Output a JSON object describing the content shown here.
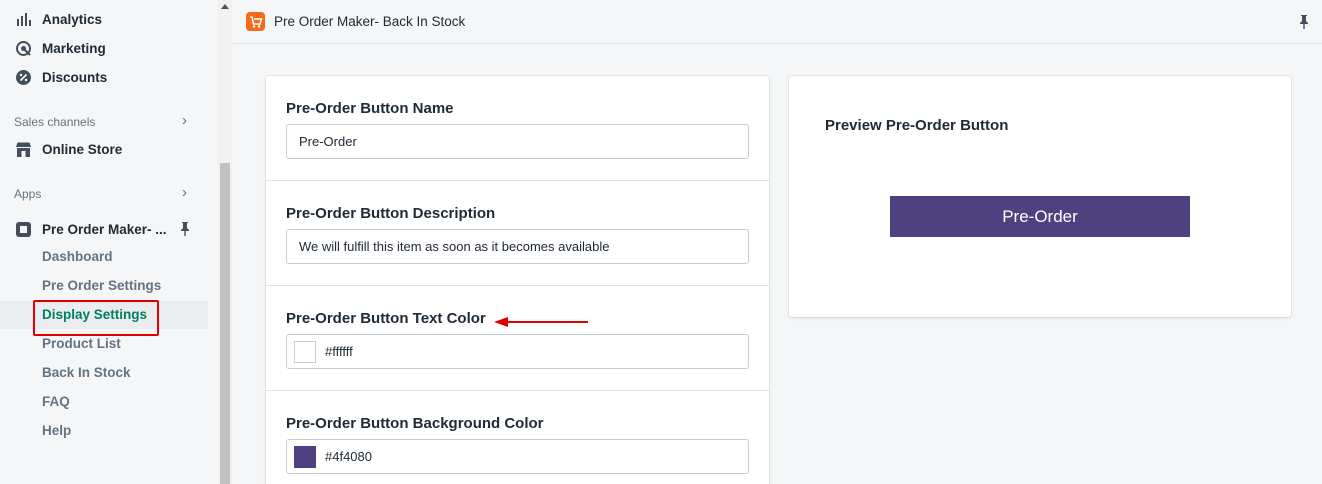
{
  "sidebar": {
    "nav": [
      {
        "label": "Analytics",
        "icon": "analytics-icon"
      },
      {
        "label": "Marketing",
        "icon": "marketing-icon"
      },
      {
        "label": "Discounts",
        "icon": "discounts-icon"
      }
    ],
    "sales_channels_label": "Sales channels",
    "online_store_label": "Online Store",
    "apps_label": "Apps",
    "app_name": "Pre Order Maker- ...",
    "sub_items": [
      "Dashboard",
      "Pre Order Settings",
      "Display Settings",
      "Product List",
      "Back In Stock",
      "FAQ",
      "Help"
    ],
    "active_item": "Display Settings"
  },
  "topbar": {
    "title": "Pre Order Maker- Back In Stock"
  },
  "form": {
    "button_name": {
      "label": "Pre-Order Button Name",
      "value": "Pre-Order"
    },
    "button_description": {
      "label": "Pre-Order Button Description",
      "value": "We will fulfill this item as soon as it becomes available"
    },
    "text_color": {
      "label": "Pre-Order Button Text Color",
      "value": "#ffffff"
    },
    "background_color": {
      "label": "Pre-Order Button Background Color",
      "value": "#4f4080"
    }
  },
  "preview": {
    "title": "Preview Pre-Order Button",
    "button_label": "Pre-Order"
  },
  "colors": {
    "accent_green": "#007f5f",
    "highlight_red": "#e00000",
    "button_bg": "#4f4080",
    "button_text": "#ffffff"
  }
}
